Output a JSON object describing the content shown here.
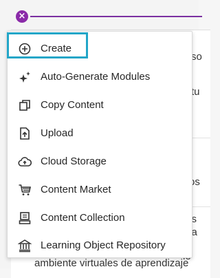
{
  "background": {
    "fragments": [
      "so",
      "tu",
      "os",
      "o s",
      "nta",
      "ta",
      "ie"
    ],
    "bottom_text": "ambiente virtuales de aprendizaje"
  },
  "close_icon": "close-icon",
  "menu": {
    "items": [
      {
        "label": "Create",
        "icon": "plus-circle-icon",
        "focused": true
      },
      {
        "label": "Auto-Generate Modules",
        "icon": "sparkle-icon"
      },
      {
        "label": "Copy Content",
        "icon": "copy-icon"
      },
      {
        "label": "Upload",
        "icon": "upload-icon"
      },
      {
        "label": "Cloud Storage",
        "icon": "cloud-upload-icon"
      },
      {
        "label": "Content Market",
        "icon": "cart-icon"
      },
      {
        "label": "Content Collection",
        "icon": "collection-icon"
      },
      {
        "label": "Learning Object Repository",
        "icon": "repository-icon"
      }
    ]
  },
  "colors": {
    "accent_purple": "#8a2aa8",
    "focus_ring": "#22a6c8"
  }
}
